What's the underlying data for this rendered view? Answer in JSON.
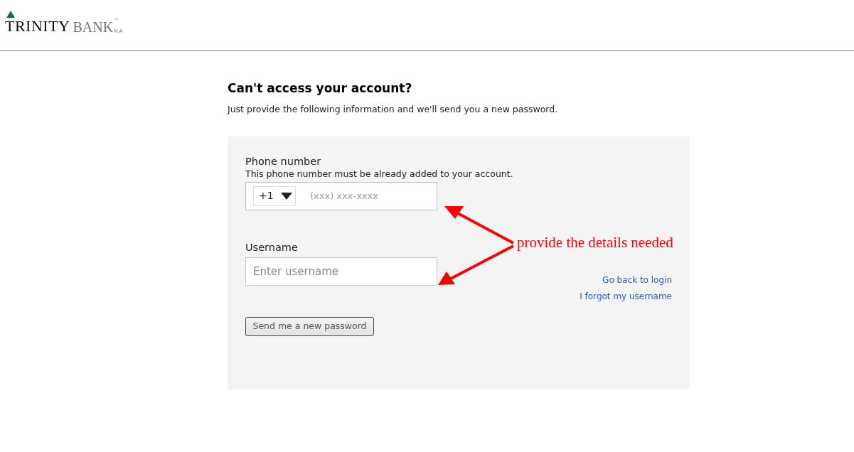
{
  "logo": {
    "name": "TRINITY",
    "bank": "BANK",
    "trademark": "™",
    "suffix": "N.A"
  },
  "title": "Can't access your account?",
  "subtitle": "Just provide the following information and we'll send you a new password.",
  "phone": {
    "label": "Phone number",
    "hint": "This phone number must be already added to your account.",
    "country_code": "+1",
    "placeholder": "(xxx) xxx-xxxx"
  },
  "username": {
    "label": "Username",
    "placeholder": "Enter username"
  },
  "links": [
    "Go back to login",
    "I forgot my username"
  ],
  "submit": "Send me a new password",
  "annotation": "provide the details needed"
}
